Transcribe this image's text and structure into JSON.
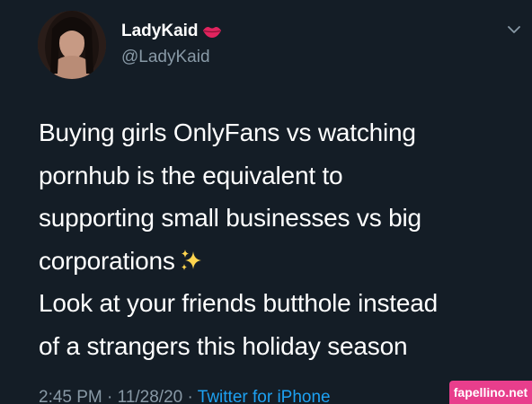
{
  "tweet": {
    "display_name": "LadyKaid",
    "handle": "@LadyKaid",
    "lines": [
      "Buying girls OnlyFans vs watching",
      "pornhub is the equivalent to",
      "supporting small businesses vs big",
      "corporations",
      "Look at your friends butthole instead",
      "of a strangers this holiday season"
    ],
    "time": "2:45 PM",
    "date": "11/28/20",
    "separator": " · ",
    "source": "Twitter for iPhone"
  },
  "icons": {
    "badge": "kiss-lips-icon",
    "sparkles": "sparkles-icon",
    "menu": "chevron-down-icon"
  },
  "watermark": "fapellino.net",
  "colors": {
    "background": "#141d26",
    "text": "#ffffff",
    "secondary": "#8899a6",
    "link": "#1da1f2",
    "watermark_bg": "#e83e8c"
  }
}
